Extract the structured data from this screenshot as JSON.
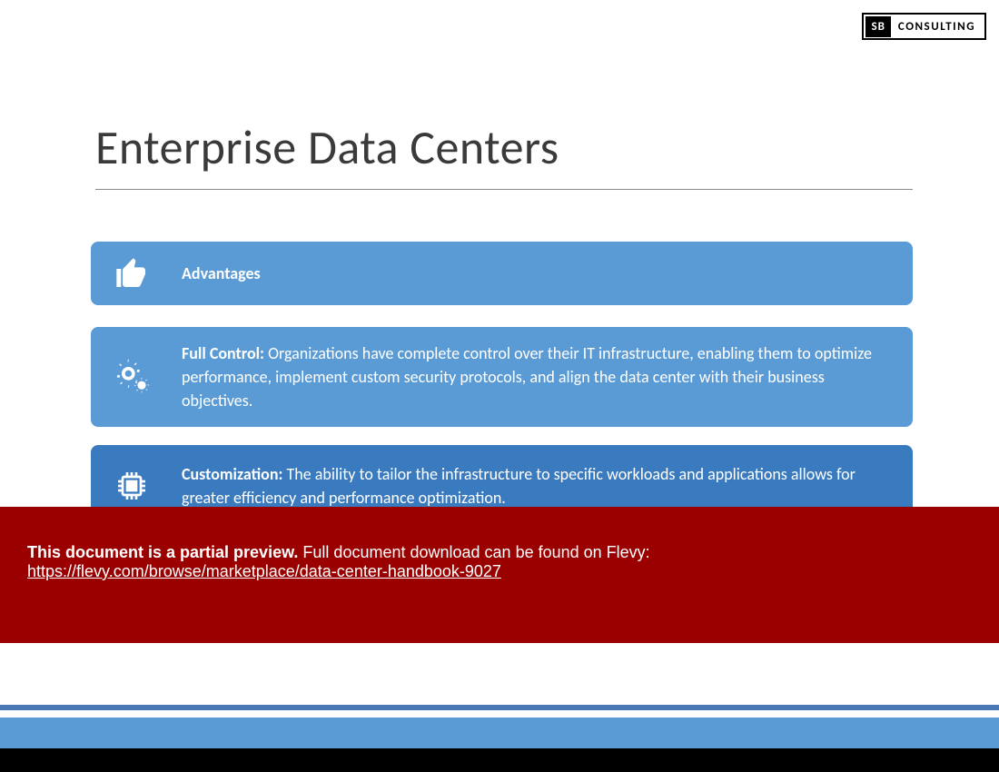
{
  "logo": {
    "sb": "SB",
    "text": "CONSULTING"
  },
  "title": "Enterprise Data Centers",
  "cards": {
    "header": {
      "label": "Advantages"
    },
    "item1": {
      "label": "Full Control:",
      "text": " Organizations have complete control over their IT infrastructure, enabling them to optimize performance, implement custom security protocols, and align the data center with their business objectives."
    },
    "item2": {
      "label": "Customization:",
      "text": " The ability to tailor the infrastructure to specific workloads and applications allows for greater efficiency and performance optimization."
    }
  },
  "preview": {
    "bold": "This document is a partial preview.",
    "rest": "  Full document download can be found on Flevy:",
    "url": "https://flevy.com/browse/marketplace/data-center-handbook-9027"
  }
}
